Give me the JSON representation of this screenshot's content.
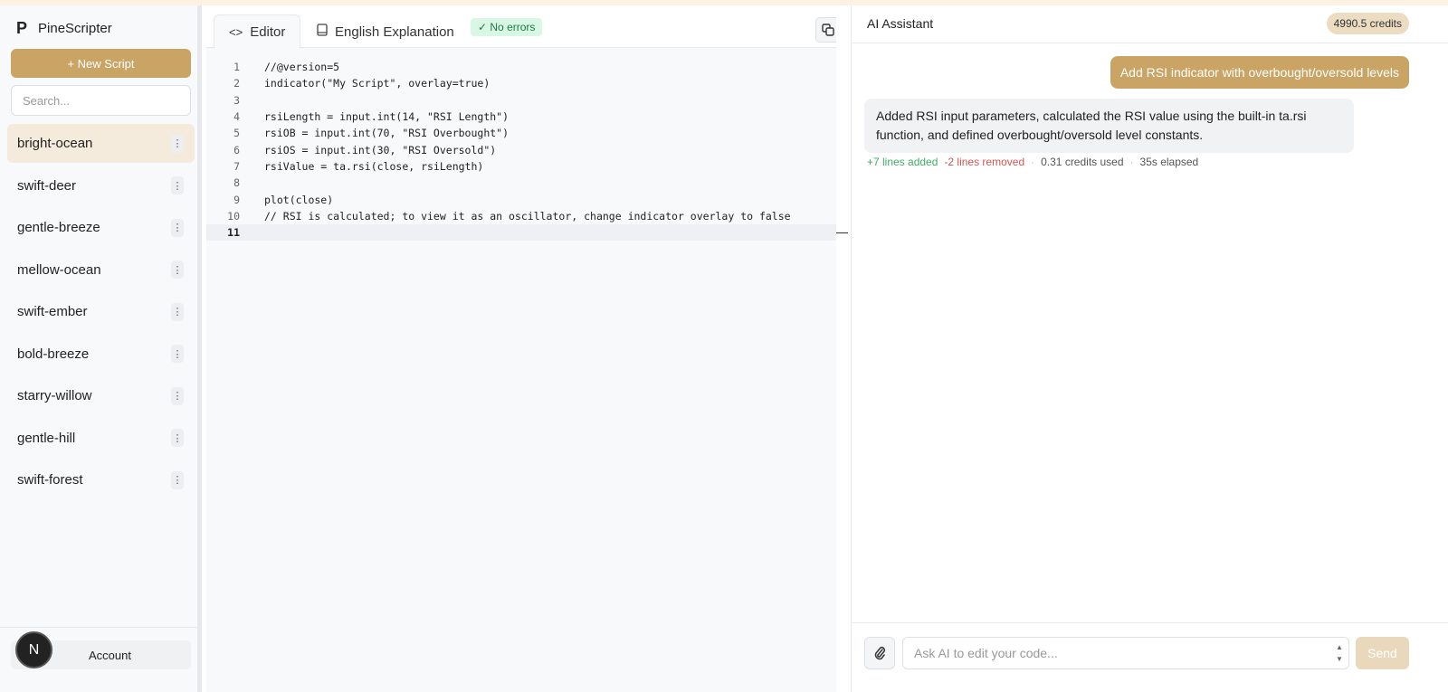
{
  "app": {
    "name": "PineScripter",
    "logo": "P"
  },
  "sidebar": {
    "new_script_label": "+ New Script",
    "search_placeholder": "Search...",
    "items": [
      {
        "label": "bright-ocean"
      },
      {
        "label": "swift-deer"
      },
      {
        "label": "gentle-breeze"
      },
      {
        "label": "mellow-ocean"
      },
      {
        "label": "swift-ember"
      },
      {
        "label": "bold-breeze"
      },
      {
        "label": "starry-willow"
      },
      {
        "label": "gentle-hill"
      },
      {
        "label": "swift-forest"
      }
    ],
    "active_index": 0,
    "account_label": "Account",
    "avatar_letter": "N"
  },
  "editor": {
    "tabs": [
      {
        "label": "Editor",
        "icon": "code-icon"
      },
      {
        "label": "English Explanation",
        "icon": "book-icon"
      }
    ],
    "status_badge": "✓ No errors",
    "lines": [
      {
        "n": "1",
        "text": "//@version=5"
      },
      {
        "n": "2",
        "text": "indicator(\"My Script\", overlay=true)"
      },
      {
        "n": "3",
        "text": ""
      },
      {
        "n": "4",
        "text": "rsiLength = input.int(14, \"RSI Length\")"
      },
      {
        "n": "5",
        "text": "rsiOB = input.int(70, \"RSI Overbought\")"
      },
      {
        "n": "6",
        "text": "rsiOS = input.int(30, \"RSI Oversold\")"
      },
      {
        "n": "7",
        "text": "rsiValue = ta.rsi(close, rsiLength)"
      },
      {
        "n": "8",
        "text": ""
      },
      {
        "n": "9",
        "text": "plot(close)"
      },
      {
        "n": "10",
        "text": "// RSI is calculated; to view it as an oscillator, change indicator overlay to false"
      },
      {
        "n": "11",
        "text": ""
      }
    ],
    "current_line": 11
  },
  "assistant": {
    "title": "AI Assistant",
    "credits": "4990.5 credits",
    "user_message": "Add RSI indicator with overbought/oversold levels",
    "ai_message": "Added RSI input parameters, calculated the RSI value using the built-in ta.rsi function, and defined overbought/oversold level constants.",
    "meta": {
      "added": "+7 lines added",
      "removed": "-2 lines removed",
      "credits_used": "0.31 credits used",
      "elapsed": "35s elapsed",
      "sep": "·"
    },
    "input_placeholder": "Ask AI to edit your code...",
    "send_label": "Send"
  },
  "colors": {
    "accent": "#c9a465",
    "success": "#3fae61",
    "danger": "#d9534f"
  }
}
